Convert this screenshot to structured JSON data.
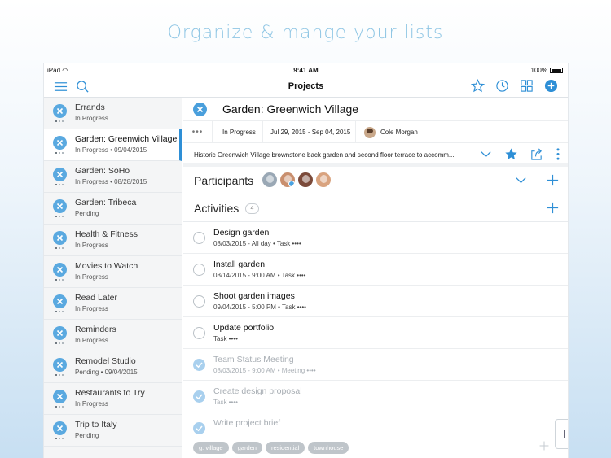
{
  "headline": "Organize & mange your lists",
  "status_bar": {
    "carrier": "iPad",
    "time": "9:41 AM",
    "battery": "100%"
  },
  "nav": {
    "title": "Projects",
    "left_icons": [
      "menu-icon",
      "search-icon"
    ],
    "right_icons": [
      "star-icon",
      "clock-icon",
      "grid-icon",
      "add-icon"
    ]
  },
  "sidebar": {
    "items": [
      {
        "title": "Errands",
        "subtitle": "In Progress"
      },
      {
        "title": "Garden: Greenwich Village",
        "subtitle": "In Progress • 09/04/2015",
        "selected": true
      },
      {
        "title": "Garden: SoHo",
        "subtitle": "In Progress • 08/28/2015"
      },
      {
        "title": "Garden: Tribeca",
        "subtitle": "Pending"
      },
      {
        "title": "Health & Fitness",
        "subtitle": "In Progress"
      },
      {
        "title": "Movies to Watch",
        "subtitle": "In Progress"
      },
      {
        "title": "Read Later",
        "subtitle": "In Progress"
      },
      {
        "title": "Reminders",
        "subtitle": "In Progress"
      },
      {
        "title": "Remodel Studio",
        "subtitle": "Pending • 09/04/2015"
      },
      {
        "title": "Restaurants to Try",
        "subtitle": "In Progress"
      },
      {
        "title": "Trip to Italy",
        "subtitle": "Pending"
      }
    ]
  },
  "detail": {
    "title": "Garden: Greenwich Village",
    "meta": {
      "dots": "•••",
      "status": "In Progress",
      "dates": "Jul 29, 2015 - Sep 04, 2015",
      "owner": "Cole Morgan"
    },
    "description": "Historic Greenwich Village brownstone back garden and second floor terrace to accomm...",
    "participants_label": "Participants",
    "activities_label": "Activities",
    "activities_count": "4",
    "activities": [
      {
        "title": "Design garden",
        "subtitle": "08/03/2015 - All day • Task ••••",
        "done": false
      },
      {
        "title": "Install garden",
        "subtitle": "08/14/2015 - 9:00 AM • Task ••••",
        "done": false
      },
      {
        "title": "Shoot garden images",
        "subtitle": "09/04/2015 - 5:00 PM • Task ••••",
        "done": false
      },
      {
        "title": "Update portfolio",
        "subtitle": "Task ••••",
        "done": false
      },
      {
        "title": "Team Status Meeting",
        "subtitle": "08/03/2015 - 9:00 AM • Meeting ••••",
        "done": true
      },
      {
        "title": "Create design proposal",
        "subtitle": "Task ••••",
        "done": true
      },
      {
        "title": "Write project brief",
        "subtitle": "",
        "done": true
      }
    ],
    "tags": [
      "g. village",
      "garden",
      "residential",
      "townhouse"
    ]
  },
  "colors": {
    "accent": "#2e8fd6",
    "headline": "#8fc6e4",
    "avatar_colors": [
      "#9aa8b5",
      "#c98f6e",
      "#7b4a3a",
      "#d9a37f"
    ]
  }
}
